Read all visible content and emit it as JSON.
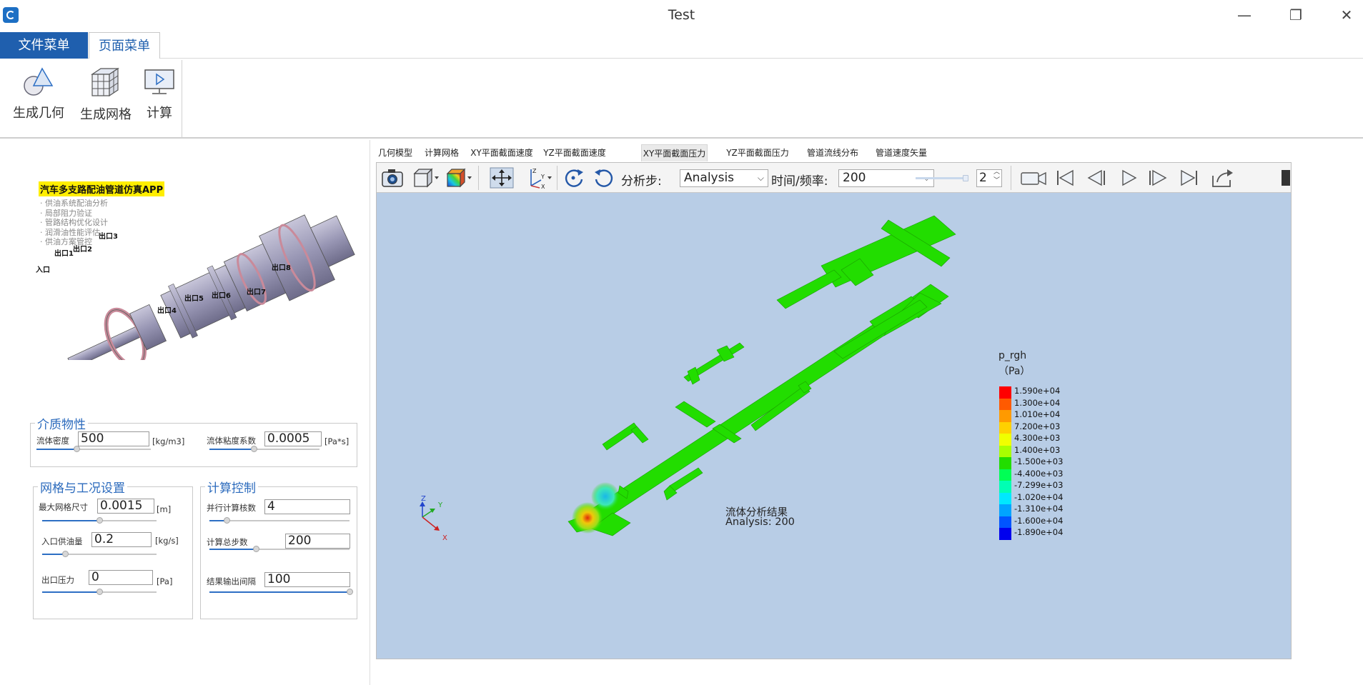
{
  "window": {
    "title": "Test",
    "minimize_glyph": "—",
    "maximize_glyph": "❐",
    "close_glyph": "✕"
  },
  "menu": {
    "file_tab": "文件菜单",
    "page_tab": "页面菜单"
  },
  "ribbon": {
    "buttons": [
      {
        "label": "生成几何",
        "icon": "geometry-icon"
      },
      {
        "label": "生成网格",
        "icon": "mesh-icon"
      },
      {
        "label": "计算",
        "icon": "compute-icon"
      }
    ]
  },
  "illustration": {
    "title": "汽车多支路配油管道仿真APP",
    "bullets": [
      "· 供油系统配油分析",
      "· 局部阻力验证",
      "· 管路结构优化设计",
      "· 润滑油性能评估",
      "· 供油方案管控"
    ],
    "callouts": [
      "入口",
      "出口1",
      "出口2",
      "出口3",
      "出口4",
      "出口5",
      "出口6",
      "出口7",
      "出口8"
    ]
  },
  "media_props": {
    "title": "介质物性",
    "density": {
      "label": "流体密度",
      "value": "500",
      "unit": "[kg/m3]",
      "level": 0.35
    },
    "viscosity": {
      "label": "流体粘度系数",
      "value": "0.0005",
      "unit": "[Pa*s]",
      "level": 0.4
    }
  },
  "mesh_conditions": {
    "title": "网格与工况设置",
    "max_mesh": {
      "label": "最大网格尺寸",
      "value": "0.0015",
      "unit": "[m]",
      "level": 0.5
    },
    "inlet_flow": {
      "label": "入口供油量",
      "value": "0.2",
      "unit": "[kg/s]",
      "level": 0.2
    },
    "outlet_pressure": {
      "label": "出口压力",
      "value": "0",
      "unit": "[Pa]",
      "level": 0.5
    }
  },
  "calc_control": {
    "title": "计算控制",
    "cores": {
      "label": "并行计算核数",
      "value": "4",
      "level": 0.12
    },
    "total_steps": {
      "label": "计算总步数",
      "value": "200",
      "level": 0.33
    },
    "output_interval": {
      "label": "结果输出间隔",
      "value": "100",
      "level": 1.0
    }
  },
  "view_tabs": [
    "几何模型",
    "计算网格",
    "XY平面截面速度",
    "YZ平面截面速度",
    "XY平面截面压力",
    "YZ平面截面压力",
    "管道流线分布",
    "管道速度矢量"
  ],
  "active_view_tab": 4,
  "toolbar": {
    "step_label": "分析步:",
    "step_value": "Analysis",
    "time_label": "时间/频率:",
    "time_value": "200",
    "spin_value": "2",
    "icons": [
      "camera-icon",
      "cube-view-icon",
      "color-map-icon",
      "pan-icon",
      "axes-icon",
      "rotate-ccw-icon",
      "rotate-cw-icon",
      "record-video-icon",
      "first-frame-icon",
      "prev-frame-icon",
      "play-icon",
      "next-frame-icon",
      "last-frame-icon",
      "export-icon"
    ]
  },
  "result": {
    "caption": "流体分析结果",
    "analysis_line": "Analysis: 200",
    "legend_title": "p_rgh",
    "legend_unit": "（Pa）",
    "legend_values": [
      "1.590e+04",
      "1.300e+04",
      "1.010e+04",
      "7.200e+03",
      "4.300e+03",
      "1.400e+03",
      "-1.500e+03",
      "-4.400e+03",
      "-7.299e+03",
      "-1.020e+04",
      "-1.310e+04",
      "-1.600e+04",
      "-1.890e+04"
    ],
    "legend_colors": [
      "#ff0000",
      "#ff5a00",
      "#ff9a00",
      "#ffd000",
      "#f0ff00",
      "#a8ff00",
      "#22dd00",
      "#00ff55",
      "#00ffb4",
      "#00e8ff",
      "#00a4ff",
      "#0055ff",
      "#0000ee"
    ],
    "axis_labels": {
      "x": "X",
      "y": "Y",
      "z": "Z"
    }
  }
}
